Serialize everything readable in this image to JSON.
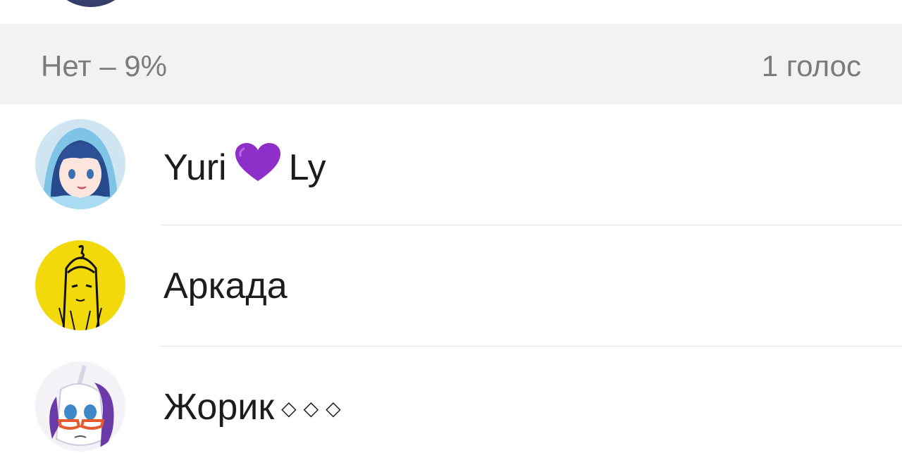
{
  "option": {
    "title": "Нет – 9%",
    "votes": "1 голос"
  },
  "voters": [
    {
      "name_part1": "Yuri",
      "emoji": "purple-heart",
      "name_part2": "Ly",
      "avatar": "anime-girl-blue-hood"
    },
    {
      "name": "Аркада",
      "avatar": "anime-girl-yellow-sketch"
    },
    {
      "name": "Жорик",
      "decoration": "◇◇◇",
      "avatar": "white-pony-glasses"
    }
  ],
  "colors": {
    "header_bg": "#f2f2f2",
    "header_text": "#7b7b7b",
    "name_text": "#1c1c1c",
    "heart": "#8e2fc9",
    "divider": "#e2e2e2"
  }
}
